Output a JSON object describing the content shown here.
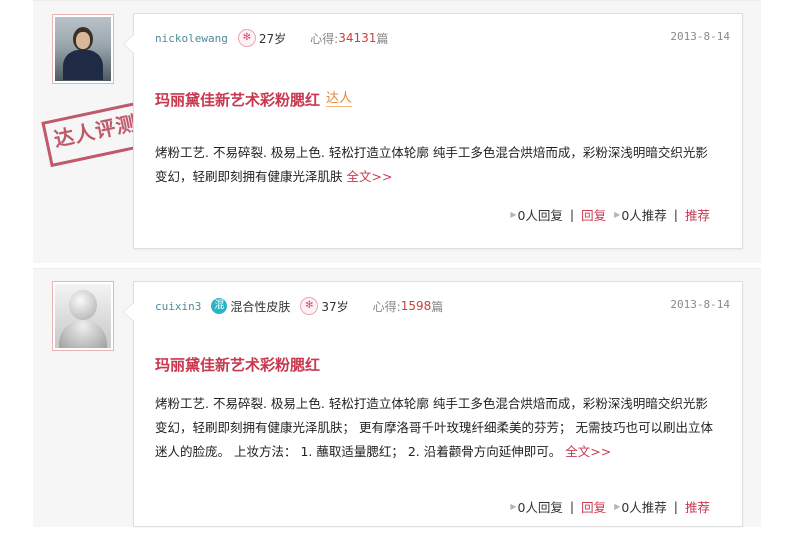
{
  "reviews": [
    {
      "username": "nickolewang",
      "age": "27岁",
      "xinde_label": "心得:",
      "xinde_count": "34131",
      "xinde_unit": "篇",
      "date": "2013-8-14",
      "title": "玛丽黛佳新艺术彩粉腮红",
      "title_badge": "达人",
      "stamp_text": "达人评测",
      "text": "烤粉工艺. 不易碎裂. 极易上色. 轻松打造立体轮廓  纯手工多色混合烘焙而成，彩粉深浅明暗交织光影变幻，轻刷即刻拥有健康光泽肌肤",
      "more": "全文>>",
      "reply_count": "0人回复",
      "reply_btn": "回复",
      "recommend_count": "0人推荐",
      "recommend_btn": "推荐"
    },
    {
      "username": "cuixin3",
      "skin_icon": "混",
      "skin_type": "混合性皮肤",
      "age": "37岁",
      "xinde_label": "心得:",
      "xinde_count": "1598",
      "xinde_unit": "篇",
      "date": "2013-8-14",
      "title": "玛丽黛佳新艺术彩粉腮红",
      "text": "烤粉工艺. 不易碎裂. 极易上色. 轻松打造立体轮廓  纯手工多色混合烘焙而成，彩粉深浅明暗交织光影变幻，轻刷即刻拥有健康光泽肌肤；  更有摩洛哥千叶玫瑰纤细柔美的芬芳；  无需技巧也可以刷出立体迷人的脸庞。  上妆方法：  1. 蘸取适量腮红；  2. 沿着颧骨方向延伸即可。",
      "more": "全文>>",
      "reply_count": "0人回复",
      "reply_btn": "回复",
      "recommend_count": "0人推荐",
      "recommend_btn": "推荐"
    }
  ],
  "icons": {
    "flower": "✻",
    "arrow": "▶"
  },
  "colors": {
    "accent": "#c8384f",
    "username": "#4e8a9a",
    "count": "#c74040"
  }
}
